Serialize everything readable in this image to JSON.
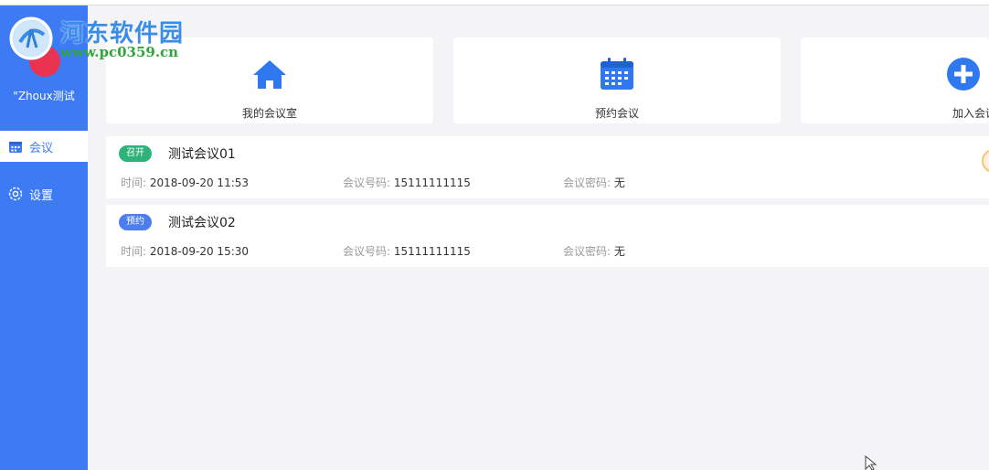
{
  "watermark": {
    "title": "河东软件园",
    "url": "www.pc0359.cn"
  },
  "user": {
    "name": "\"Zhoux测试"
  },
  "sidebar": {
    "items": [
      {
        "label": "会议",
        "icon": "calendar-icon",
        "active": true
      },
      {
        "label": "设置",
        "icon": "gear-icon",
        "active": false
      }
    ]
  },
  "actions": [
    {
      "label": "我的会议室",
      "icon": "home-icon"
    },
    {
      "label": "预约会议",
      "icon": "calendar-icon"
    },
    {
      "label": "加入会议",
      "icon": "plus-circle-icon"
    }
  ],
  "meetings": [
    {
      "status": "召开",
      "status_color": "#2fb27a",
      "title": "测试会议01",
      "time_label": "时间:",
      "time": "2018-09-20 11:53",
      "number_label": "会议号码:",
      "number": "15111111115",
      "password_label": "会议密码:",
      "password": "无"
    },
    {
      "status": "预约",
      "status_color": "#4d7ef0",
      "title": "测试会议02",
      "time_label": "时间:",
      "time": "2018-09-20 15:30",
      "number_label": "会议号码:",
      "number": "15111111115",
      "password_label": "会议密码:",
      "password": "无"
    }
  ],
  "colors": {
    "sidebar": "#3d7bf5",
    "accent": "#3d7bf5",
    "background": "#f4f4f6"
  }
}
